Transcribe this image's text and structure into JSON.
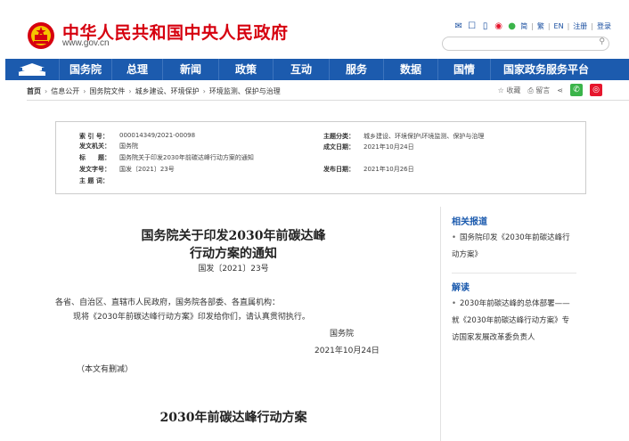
{
  "header": {
    "title": "中华人民共和国中央人民政府",
    "url": "www.gov.cn",
    "links": [
      "简",
      "繁",
      "EN",
      "注册",
      "登录"
    ],
    "search_placeholder": ""
  },
  "nav": {
    "items": [
      "国务院",
      "总理",
      "新闻",
      "政策",
      "互动",
      "服务",
      "数据",
      "国情",
      "国家政务服务平台"
    ]
  },
  "breadcrumb": [
    "首页",
    "信息公开",
    "国务院文件",
    "城乡建设、环境保护",
    "环境监测、保护与治理"
  ],
  "tools": {
    "favorite": "收藏",
    "print": "留言"
  },
  "info": {
    "index_label": "索 引 号：",
    "index_value": "000014349/2021-00098",
    "org_label": "发文机关：",
    "org_value": "国务院",
    "title_label": "标　　题：",
    "title_value": "国务院关于印发2030年前碳达峰行动方案的通知",
    "docno_label": "发文字号：",
    "docno_value": "国发〔2021〕23号",
    "subject_label": "主 题 词：",
    "subject_value": "",
    "category_label": "主题分类：",
    "category_value": "城乡建设、环境保护\\环境监测、保护与治理",
    "created_label": "成文日期：",
    "created_value": "2021年10月24日",
    "published_label": "发布日期：",
    "published_value": "2021年10月26日"
  },
  "doc": {
    "title_line1": "国务院关于印发2030年前碳达峰",
    "title_line2": "行动方案的通知",
    "number": "国发〔2021〕23号",
    "recipients": "各省、自治区、直辖市人民政府，国务院各部委、各直属机构：",
    "body": "现将《2030年前碳达峰行动方案》印发给你们，请认真贯彻执行。",
    "signer": "国务院",
    "date": "2021年10月24日",
    "note": "（本文有删减）",
    "subtitle": "2030年前碳达峰行动方案"
  },
  "sidebar": {
    "related_title": "相关报道",
    "related_items": [
      "国务院印发《2030年前碳达峰行动方案》"
    ],
    "interpret_title": "解读",
    "interpret_items": [
      "2030年前碳达峰的总体部署——就《2030年前碳达峰行动方案》专访国家发展改革委负责人"
    ]
  },
  "colors": {
    "brand_red": "#d6000f",
    "nav_blue": "#1c5bae",
    "wechat_green": "#3bb44a",
    "weibo_red": "#e6162d"
  }
}
